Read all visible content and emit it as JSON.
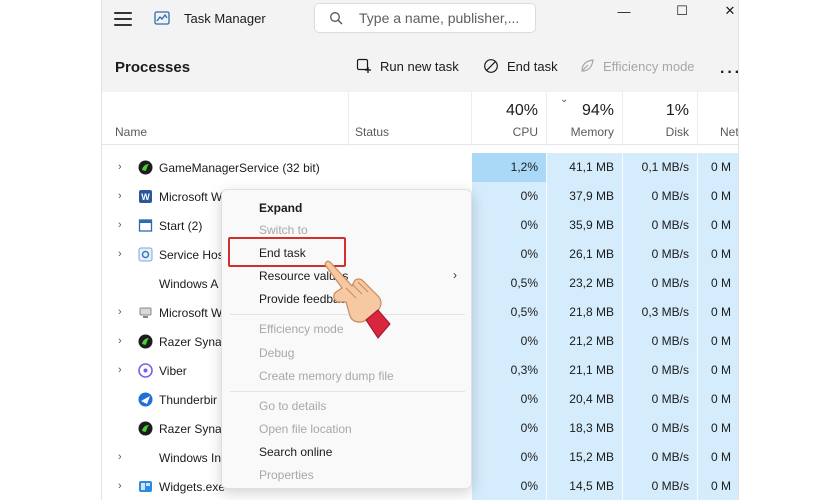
{
  "window": {
    "title": "Task Manager",
    "search_placeholder": "Type a name, publisher,...",
    "controls": {
      "minimize": "—",
      "maximize": "☐",
      "close": "✕"
    }
  },
  "toolbar": {
    "page_title": "Processes",
    "run_new_task": "Run new task",
    "end_task": "End task",
    "efficiency_mode": "Efficiency mode",
    "more": "···"
  },
  "columns": {
    "name": "Name",
    "status": "Status",
    "cpu": {
      "pct": "40%",
      "label": "CPU"
    },
    "memory": {
      "pct": "94%",
      "label": "Memory"
    },
    "disk": {
      "pct": "1%",
      "label": "Disk"
    },
    "network": {
      "label": "Net"
    }
  },
  "rows": [
    {
      "name": "GameManagerService (32 bit)",
      "icon": "razer-icon",
      "expand": true,
      "cpu": "1,2%",
      "memory": "41,1 MB",
      "disk": "0,1 MB/s",
      "net": "0 M",
      "hot": true
    },
    {
      "name": "Microsoft W",
      "icon": "word-icon",
      "expand": true,
      "cpu": "0%",
      "memory": "37,9 MB",
      "disk": "0 MB/s",
      "net": "0 M"
    },
    {
      "name": "Start (2)",
      "icon": "window-icon",
      "expand": true,
      "cpu": "0%",
      "memory": "35,9 MB",
      "disk": "0 MB/s",
      "net": "0 M"
    },
    {
      "name": "Service Hos",
      "icon": "gear-icon",
      "expand": true,
      "cpu": "0%",
      "memory": "26,1 MB",
      "disk": "0 MB/s",
      "net": "0 M"
    },
    {
      "name": "Windows A",
      "icon": "blank-icon",
      "expand": false,
      "cpu": "0,5%",
      "memory": "23,2 MB",
      "disk": "0 MB/s",
      "net": "0 M"
    },
    {
      "name": "Microsoft W",
      "icon": "network-icon",
      "expand": true,
      "cpu": "0,5%",
      "memory": "21,8 MB",
      "disk": "0,3 MB/s",
      "net": "0 M"
    },
    {
      "name": "Razer Synap",
      "icon": "razer-icon",
      "expand": true,
      "cpu": "0%",
      "memory": "21,2 MB",
      "disk": "0 MB/s",
      "net": "0 M"
    },
    {
      "name": "Viber",
      "icon": "viber-icon",
      "expand": true,
      "cpu": "0,3%",
      "memory": "21,1 MB",
      "disk": "0 MB/s",
      "net": "0 M"
    },
    {
      "name": "Thunderbir",
      "icon": "thunderbird-icon",
      "expand": false,
      "cpu": "0%",
      "memory": "20,4 MB",
      "disk": "0 MB/s",
      "net": "0 M"
    },
    {
      "name": "Razer Synap",
      "icon": "razer-icon",
      "expand": false,
      "cpu": "0%",
      "memory": "18,3 MB",
      "disk": "0 MB/s",
      "net": "0 M"
    },
    {
      "name": "Windows In",
      "icon": "blank-icon",
      "expand": true,
      "cpu": "0%",
      "memory": "15,2 MB",
      "disk": "0 MB/s",
      "net": "0 M"
    },
    {
      "name": "Widgets.exe",
      "icon": "widgets-icon",
      "expand": true,
      "cpu": "0%",
      "memory": "14,5 MB",
      "disk": "0 MB/s",
      "net": "0 M"
    }
  ],
  "context_menu": {
    "items": [
      {
        "label": "Expand",
        "style": "bold"
      },
      {
        "label": "Switch to",
        "style": "disabled"
      },
      {
        "label": "End task",
        "style": "normal",
        "highlighted": true
      },
      {
        "label": "Resource values",
        "style": "normal",
        "submenu": true
      },
      {
        "label": "Provide feedback",
        "style": "normal"
      },
      {
        "label": "Efficiency mode",
        "style": "disabled"
      },
      {
        "label": "Debug",
        "style": "disabled"
      },
      {
        "label": "Create memory dump file",
        "style": "disabled"
      },
      {
        "label": "Go to details",
        "style": "disabled"
      },
      {
        "label": "Open file location",
        "style": "disabled"
      },
      {
        "label": "Search online",
        "style": "normal"
      },
      {
        "label": "Properties",
        "style": "disabled"
      }
    ],
    "highlight_color": "#d32f2f"
  },
  "colors": {
    "accent_cell": "#d4ecfb",
    "hot_cell": "#a9d9f7",
    "razer_green": "#44d62c",
    "word_blue": "#2b579a",
    "viber_purple": "#7360f2"
  }
}
